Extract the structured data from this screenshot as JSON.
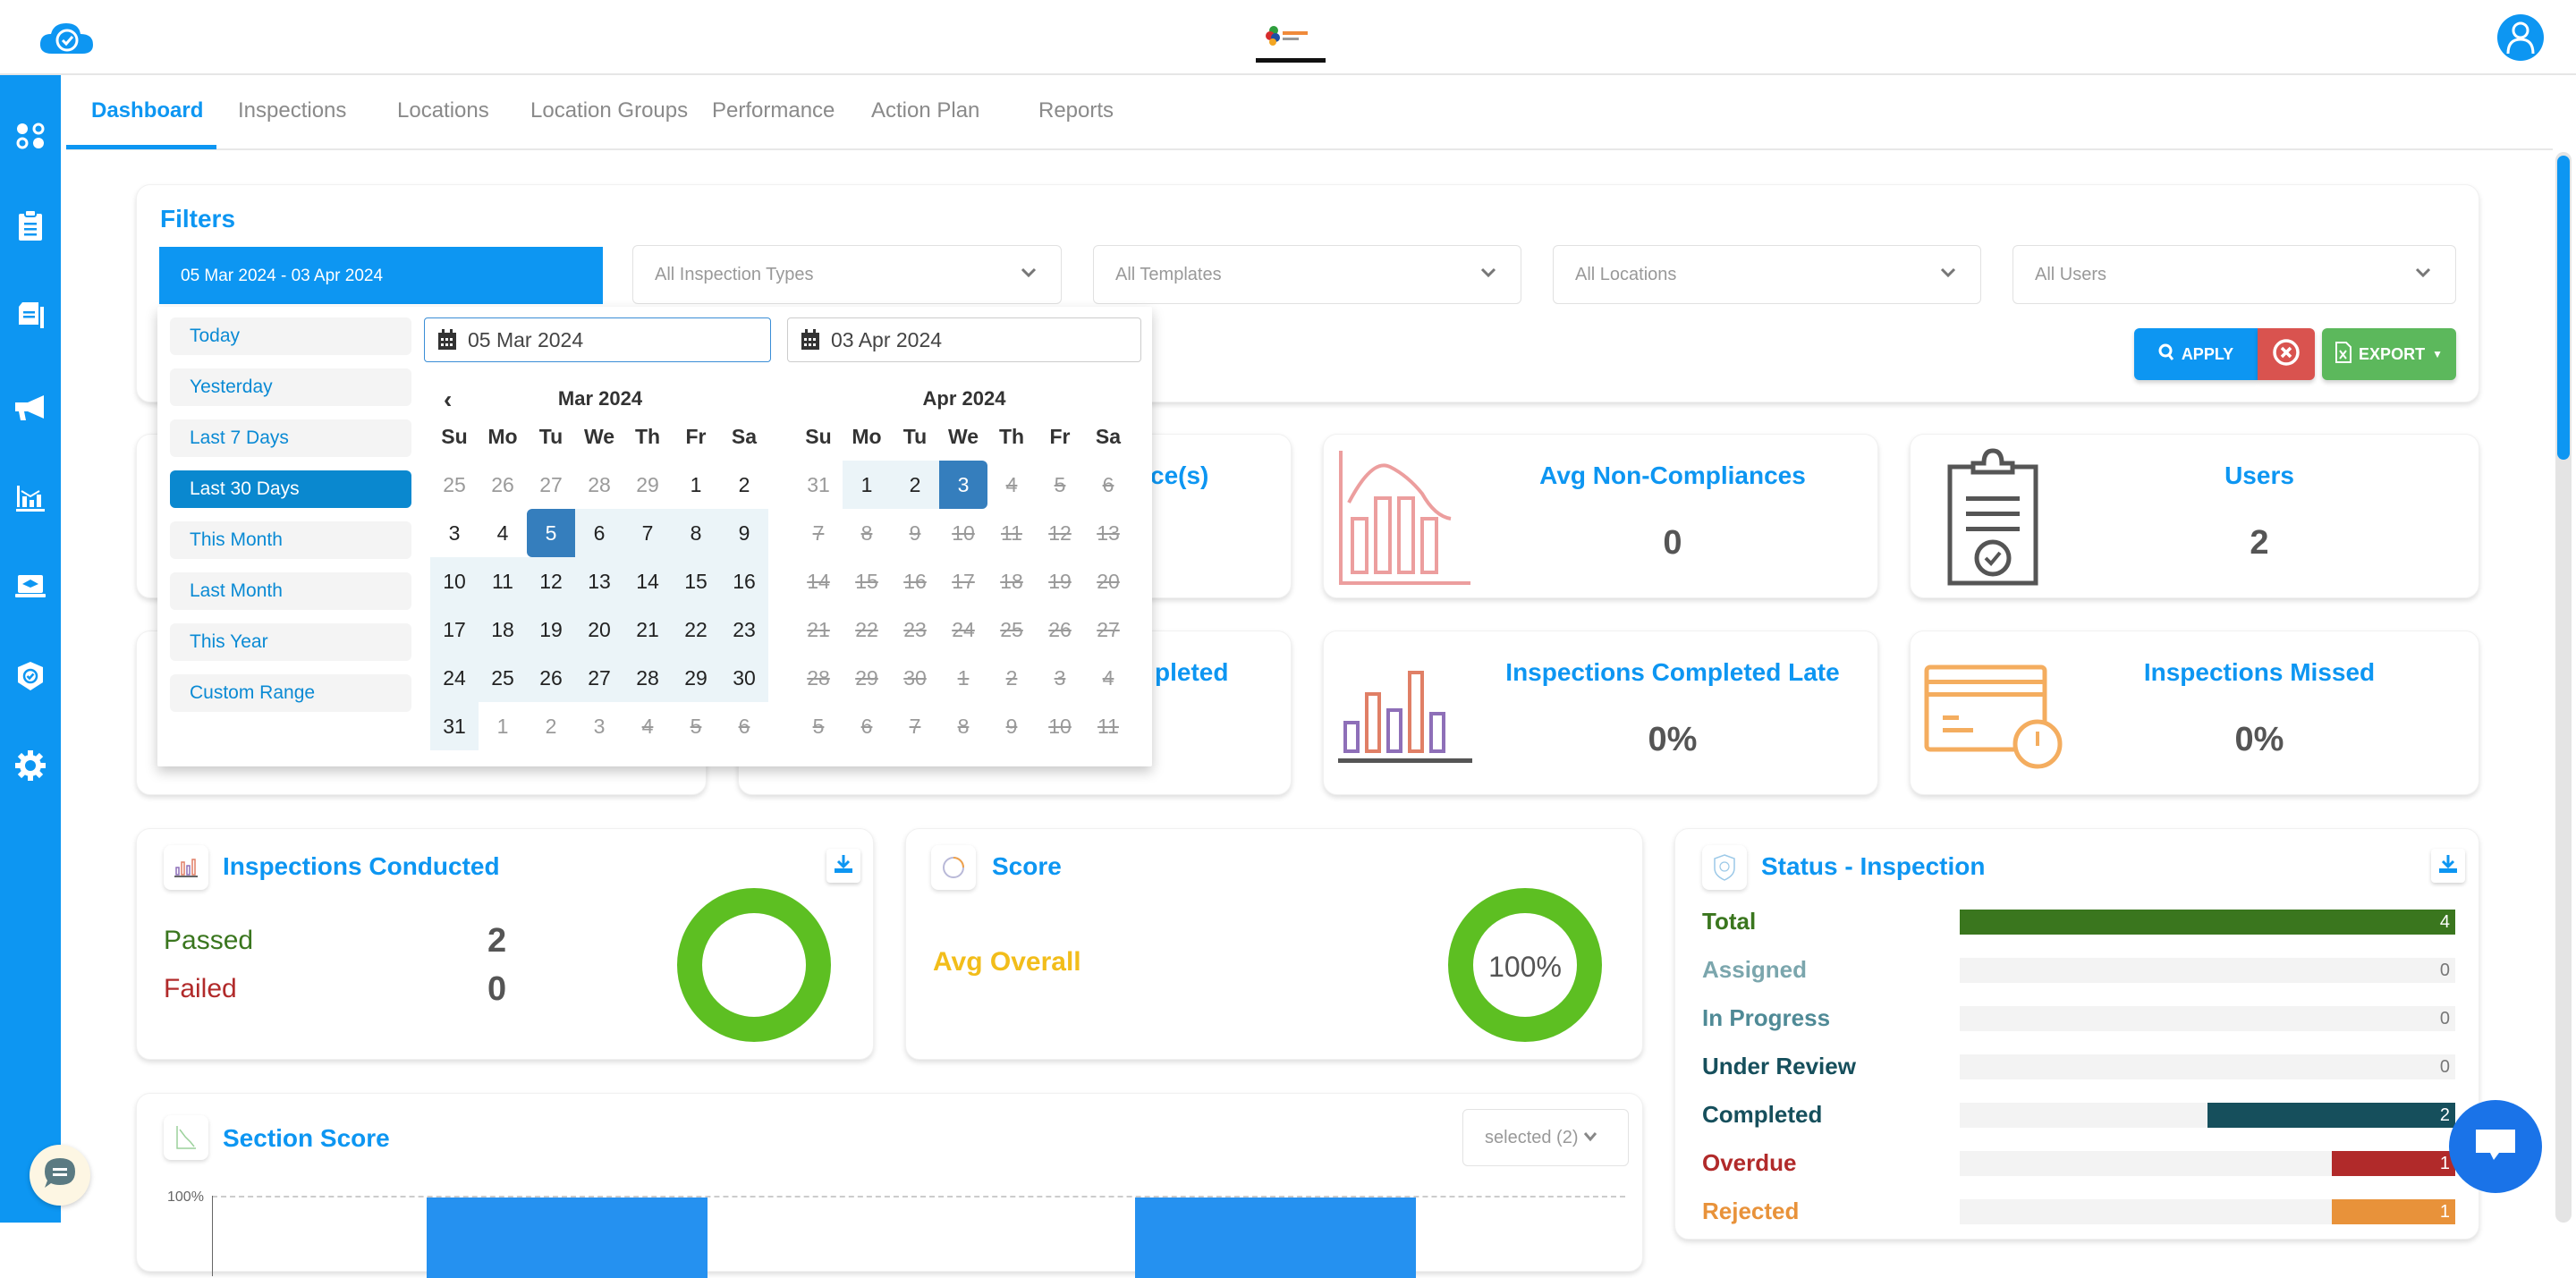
{
  "header": {
    "logo_icon": "cloud-check-icon",
    "brand_logo": "company-logo",
    "avatar_icon": "user-avatar-icon"
  },
  "sidebar": {
    "items": [
      {
        "icon": "dashboard-icon"
      },
      {
        "icon": "clipboard-icon"
      },
      {
        "icon": "documents-icon"
      },
      {
        "icon": "megaphone-icon"
      },
      {
        "icon": "analytics-icon"
      },
      {
        "icon": "training-icon"
      },
      {
        "icon": "shield-check-icon"
      },
      {
        "icon": "gear-icon"
      }
    ]
  },
  "tabs": [
    {
      "label": "Dashboard",
      "active": true
    },
    {
      "label": "Inspections"
    },
    {
      "label": "Locations"
    },
    {
      "label": "Location Groups"
    },
    {
      "label": "Performance"
    },
    {
      "label": "Action Plan"
    },
    {
      "label": "Reports"
    }
  ],
  "filters": {
    "title": "Filters",
    "date_range_value": "05 Mar 2024 - 03 Apr 2024",
    "inspection_types": "All Inspection Types",
    "templates": "All Templates",
    "locations": "All Locations",
    "users": "All Users",
    "apply_label": "APPLY",
    "export_label": "EXPORT"
  },
  "datepicker": {
    "ranges": [
      "Today",
      "Yesterday",
      "Last 7 Days",
      "Last 30 Days",
      "This Month",
      "Last Month",
      "This Year",
      "Custom Range"
    ],
    "active_range": "Last 30 Days",
    "start_input": "05 Mar 2024",
    "end_input": "03 Apr 2024",
    "weekdays": [
      "Su",
      "Mo",
      "Tu",
      "We",
      "Th",
      "Fr",
      "Sa"
    ],
    "left_month": {
      "title": "Mar 2024",
      "days": [
        {
          "d": "25",
          "s": "off"
        },
        {
          "d": "26",
          "s": "off"
        },
        {
          "d": "27",
          "s": "off"
        },
        {
          "d": "28",
          "s": "off"
        },
        {
          "d": "29",
          "s": "off"
        },
        {
          "d": "1"
        },
        {
          "d": "2"
        },
        {
          "d": "3"
        },
        {
          "d": "4"
        },
        {
          "d": "5",
          "s": "start"
        },
        {
          "d": "6",
          "s": "inrange"
        },
        {
          "d": "7",
          "s": "inrange"
        },
        {
          "d": "8",
          "s": "inrange"
        },
        {
          "d": "9",
          "s": "inrange"
        },
        {
          "d": "10",
          "s": "inrange"
        },
        {
          "d": "11",
          "s": "inrange"
        },
        {
          "d": "12",
          "s": "inrange"
        },
        {
          "d": "13",
          "s": "inrange"
        },
        {
          "d": "14",
          "s": "inrange"
        },
        {
          "d": "15",
          "s": "inrange"
        },
        {
          "d": "16",
          "s": "inrange"
        },
        {
          "d": "17",
          "s": "inrange"
        },
        {
          "d": "18",
          "s": "inrange"
        },
        {
          "d": "19",
          "s": "inrange"
        },
        {
          "d": "20",
          "s": "inrange"
        },
        {
          "d": "21",
          "s": "inrange"
        },
        {
          "d": "22",
          "s": "inrange"
        },
        {
          "d": "23",
          "s": "inrange"
        },
        {
          "d": "24",
          "s": "inrange"
        },
        {
          "d": "25",
          "s": "inrange"
        },
        {
          "d": "26",
          "s": "inrange"
        },
        {
          "d": "27",
          "s": "inrange"
        },
        {
          "d": "28",
          "s": "inrange"
        },
        {
          "d": "29",
          "s": "inrange"
        },
        {
          "d": "30",
          "s": "inrange"
        },
        {
          "d": "31",
          "s": "inrange"
        },
        {
          "d": "1",
          "s": "off"
        },
        {
          "d": "2",
          "s": "off"
        },
        {
          "d": "3",
          "s": "off"
        },
        {
          "d": "4",
          "s": "dis"
        },
        {
          "d": "5",
          "s": "dis"
        },
        {
          "d": "6",
          "s": "dis"
        }
      ]
    },
    "right_month": {
      "title": "Apr 2024",
      "days": [
        {
          "d": "31",
          "s": "off"
        },
        {
          "d": "1",
          "s": "inrange"
        },
        {
          "d": "2",
          "s": "inrange"
        },
        {
          "d": "3",
          "s": "end"
        },
        {
          "d": "4",
          "s": "dis"
        },
        {
          "d": "5",
          "s": "dis"
        },
        {
          "d": "6",
          "s": "dis"
        },
        {
          "d": "7",
          "s": "dis"
        },
        {
          "d": "8",
          "s": "dis"
        },
        {
          "d": "9",
          "s": "dis"
        },
        {
          "d": "10",
          "s": "dis"
        },
        {
          "d": "11",
          "s": "dis"
        },
        {
          "d": "12",
          "s": "dis"
        },
        {
          "d": "13",
          "s": "dis"
        },
        {
          "d": "14",
          "s": "dis"
        },
        {
          "d": "15",
          "s": "dis"
        },
        {
          "d": "16",
          "s": "dis"
        },
        {
          "d": "17",
          "s": "dis"
        },
        {
          "d": "18",
          "s": "dis"
        },
        {
          "d": "19",
          "s": "dis"
        },
        {
          "d": "20",
          "s": "dis"
        },
        {
          "d": "21",
          "s": "dis"
        },
        {
          "d": "22",
          "s": "dis"
        },
        {
          "d": "23",
          "s": "dis"
        },
        {
          "d": "24",
          "s": "dis"
        },
        {
          "d": "25",
          "s": "dis"
        },
        {
          "d": "26",
          "s": "dis"
        },
        {
          "d": "27",
          "s": "dis"
        },
        {
          "d": "28",
          "s": "dis"
        },
        {
          "d": "29",
          "s": "dis"
        },
        {
          "d": "30",
          "s": "dis"
        },
        {
          "d": "1",
          "s": "dis"
        },
        {
          "d": "2",
          "s": "dis"
        },
        {
          "d": "3",
          "s": "dis"
        },
        {
          "d": "4",
          "s": "dis"
        },
        {
          "d": "5",
          "s": "dis"
        },
        {
          "d": "6",
          "s": "dis"
        },
        {
          "d": "7",
          "s": "dis"
        },
        {
          "d": "8",
          "s": "dis"
        },
        {
          "d": "9",
          "s": "dis"
        },
        {
          "d": "10",
          "s": "dis"
        },
        {
          "d": "11",
          "s": "dis"
        }
      ]
    }
  },
  "kpis": {
    "non_compliance_partial_title": "ce(s)",
    "completed_partial_title": "pleted",
    "avg_non_compliances": {
      "title": "Avg Non-Compliances",
      "value": "0"
    },
    "users": {
      "title": "Users",
      "value": "2"
    },
    "completed_late": {
      "title": "Inspections Completed Late",
      "value": "0%"
    },
    "missed": {
      "title": "Inspections Missed",
      "value": "0%"
    }
  },
  "inspections_conducted": {
    "title": "Inspections Conducted",
    "passed_label": "Passed",
    "passed_value": "2",
    "failed_label": "Failed",
    "failed_value": "0"
  },
  "score": {
    "title": "Score",
    "avg_label": "Avg Overall",
    "donut_value": "100%"
  },
  "status_inspection": {
    "title": "Status - Inspection",
    "max": 4,
    "rows": [
      {
        "label": "Total",
        "value": 4,
        "color": "#3a761e",
        "label_color": "#3a761e"
      },
      {
        "label": "Assigned",
        "value": 0,
        "color": "#7ba6ad",
        "label_color": "#7ba6ad"
      },
      {
        "label": "In Progress",
        "value": 0,
        "color": "#4f8a96",
        "label_color": "#4f8a96"
      },
      {
        "label": "Under Review",
        "value": 0,
        "color": "#164f5c",
        "label_color": "#164f5c"
      },
      {
        "label": "Completed",
        "value": 2,
        "color": "#164f5c",
        "label_color": "#164f5c"
      },
      {
        "label": "Overdue",
        "value": 1,
        "color": "#b12a2a",
        "label_color": "#b12a2a"
      },
      {
        "label": "Rejected",
        "value": 1,
        "color": "#e8923a",
        "label_color": "#e8923a"
      }
    ]
  },
  "section_score": {
    "title": "Section Score",
    "selector": "selected (2)",
    "y_tick": "100%"
  }
}
